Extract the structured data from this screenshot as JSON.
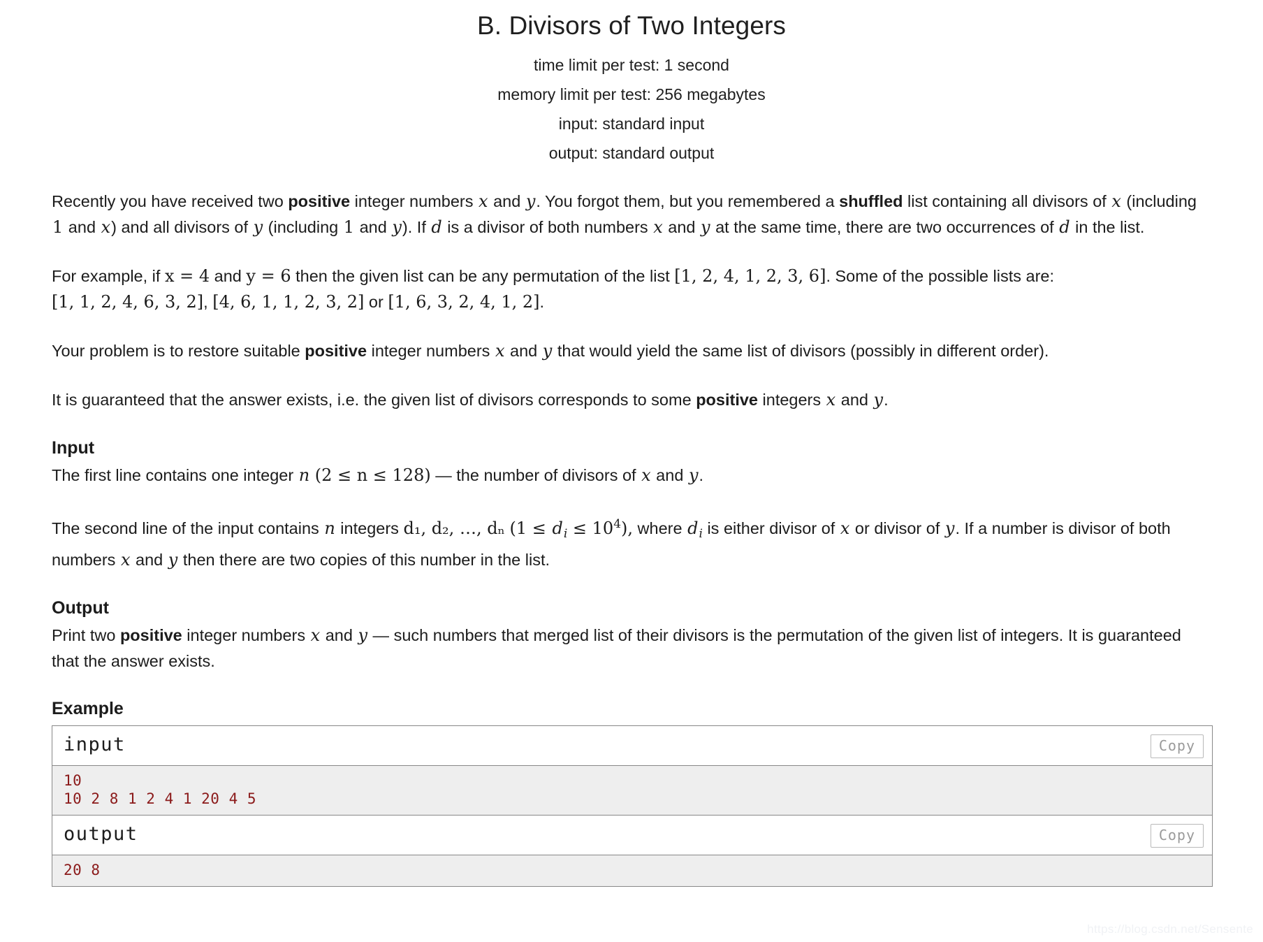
{
  "header": {
    "title": "B. Divisors of Two Integers",
    "limits": [
      "time limit per test: 1 second",
      "memory limit per test: 256 megabytes",
      "input: standard input",
      "output: standard output"
    ],
    "time_limit": "1 second",
    "memory_limit": "256 megabytes",
    "input_source": "standard input",
    "output_source": "standard output"
  },
  "statement": {
    "p1_a": "Recently you have received two ",
    "p1_positive": "positive",
    "p1_b": " integer numbers ",
    "p1_x": "x",
    "p1_c": " and ",
    "p1_y": "y",
    "p1_d": ". You forgot them, but you remembered a ",
    "p1_shuffled": "shuffled",
    "p1_e": " list containing all divisors of ",
    "p1_f": " (including ",
    "p1_one": "1",
    "p1_g": " and ",
    "p1_h": ") and all divisors of ",
    "p1_i": "). If ",
    "p1_d_var": "d",
    "p1_j": " is a divisor of both numbers ",
    "p1_k": " at the same time, there are two occurrences of ",
    "p1_l": " in the list.",
    "p2_a": "For example, if ",
    "p2_xeq": "x = 4",
    "p2_and": " and ",
    "p2_yeq": "y = 6",
    "p2_b": " then the given list can be any permutation of the list ",
    "p2_list_main": "[1, 2, 4, 1, 2, 3, 6]",
    "p2_c": ". Some of the possible lists are: ",
    "p2_list_1": "[1, 1, 2, 4, 6, 3, 2]",
    "p2_sep1": ", ",
    "p2_list_2": "[4, 6, 1, 1, 2, 3, 2]",
    "p2_or": " or ",
    "p2_list_3": "[1, 6, 3, 2, 4, 1, 2]",
    "p2_end": ".",
    "p3_a": "Your problem is to restore suitable ",
    "p3_positive": "positive",
    "p3_b": " integer numbers ",
    "p3_c": " and ",
    "p3_d": " that would yield the same list of divisors (possibly in different order).",
    "p4_a": "It is guaranteed that the answer exists, i.e. the given list of divisors corresponds to some ",
    "p4_positive": "positive",
    "p4_b": " integers ",
    "p4_c": " and ",
    "p4_d": "."
  },
  "input_section": {
    "heading": "Input",
    "p1_a": "The first line contains one integer ",
    "p1_n": "n",
    "p1_range": "(2 ≤ n ≤ 128)",
    "p1_b": " — the number of divisors of ",
    "p1_c": " and ",
    "p1_d": ".",
    "p2_a": "The second line of the input contains ",
    "p2_n": "n",
    "p2_b": " integers ",
    "p2_list": "d₁, d₂, …, dₙ",
    "p2_range_open": "(1 ≤ ",
    "p2_di": "d",
    "p2_i": "i",
    "p2_range_mid": " ≤ 10",
    "p2_exp": "4",
    "p2_range_close": "),",
    "p2_c": " where ",
    "p2_d": " is either divisor of ",
    "p2_e": " or divisor of ",
    "p2_f": ". If a number is divisor of both numbers ",
    "p2_g": " and ",
    "p2_h": " then there are two copies of this number in the list."
  },
  "output_section": {
    "heading": "Output",
    "p1_a": "Print two ",
    "p1_positive": "positive",
    "p1_b": " integer numbers ",
    "p1_c": " and ",
    "p1_d": " — such numbers that merged list of their divisors is the permutation of the given list of integers. It is guaranteed that the answer exists."
  },
  "example": {
    "heading": "Example",
    "copy_label": "Copy",
    "input_label": "input",
    "output_label": "output",
    "input_data": "10\n10 2 8 1 2 4 1 20 4 5",
    "output_data": "20 8"
  },
  "watermark": "https://blog.csdn.net/Sensente",
  "colors": {
    "text": "#1c1c1c",
    "code_red": "#8b1a1a",
    "box_border": "#888888",
    "box_body_bg": "#eeeeee",
    "copy_text": "#9a9a9a",
    "watermark": "#f0f2f5"
  }
}
